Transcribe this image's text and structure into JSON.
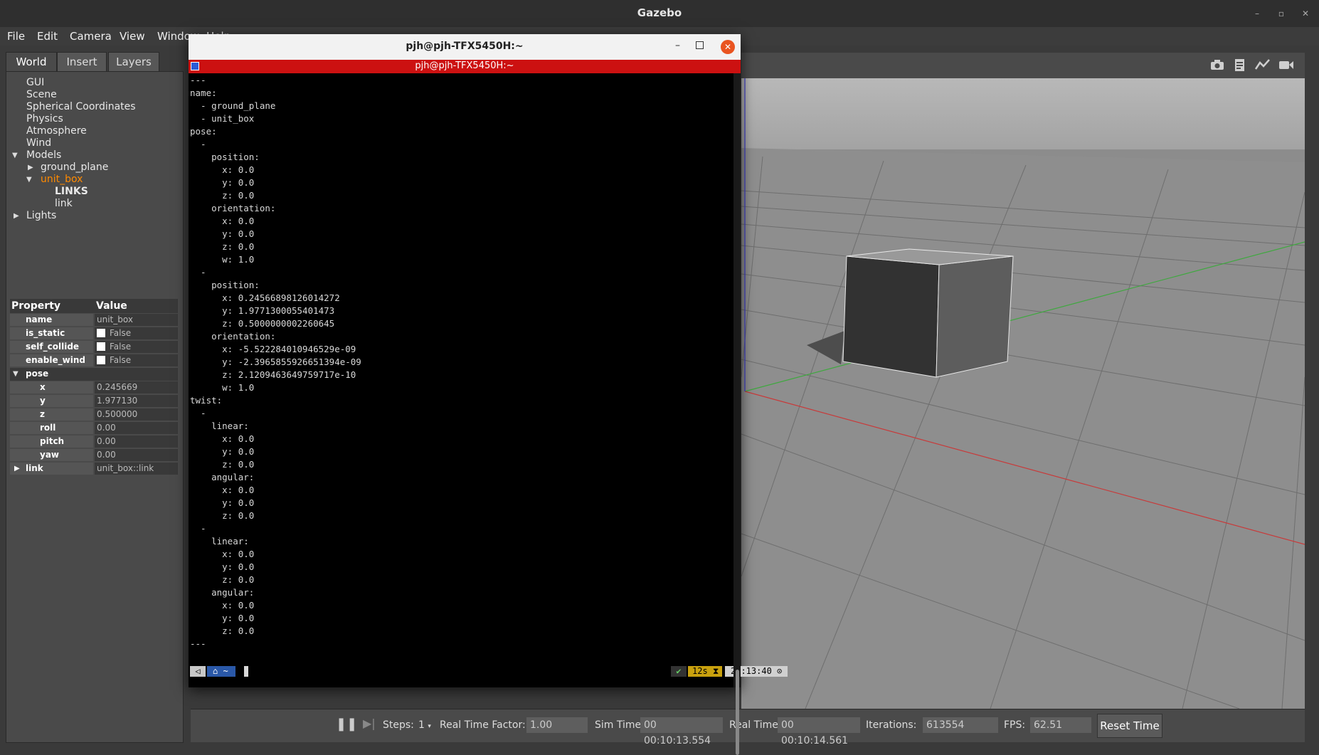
{
  "window": {
    "title": "Gazebo"
  },
  "menu": [
    "File",
    "Edit",
    "Camera",
    "View",
    "Window",
    "Help"
  ],
  "left_panel": {
    "tabs": [
      "World",
      "Insert",
      "Layers"
    ],
    "tree": {
      "gui": "GUI",
      "scene": "Scene",
      "spherical": "Spherical Coordinates",
      "physics": "Physics",
      "atmosphere": "Atmosphere",
      "wind": "Wind",
      "models": "Models",
      "ground_plane": "ground_plane",
      "unit_box": "unit_box",
      "links_header": "LINKS",
      "link": "link",
      "lights": "Lights"
    },
    "properties": {
      "header_property": "Property",
      "header_value": "Value",
      "name_label": "name",
      "name_value": "unit_box",
      "is_static_label": "is_static",
      "is_static_value": "False",
      "self_collide_label": "self_collide",
      "self_collide_value": "False",
      "enable_wind_label": "enable_wind",
      "enable_wind_value": "False",
      "pose_label": "pose",
      "x_label": "x",
      "x_value": "0.245669",
      "y_label": "y",
      "y_value": "1.977130",
      "z_label": "z",
      "z_value": "0.500000",
      "roll_label": "roll",
      "roll_value": "0.00",
      "pitch_label": "pitch",
      "pitch_value": "0.00",
      "yaw_label": "yaw",
      "yaw_value": "0.00",
      "link_label": "link",
      "link_value": "unit_box::link"
    }
  },
  "viewport_toolbar": [
    "camera-icon",
    "log-icon",
    "plot-icon",
    "video-icon"
  ],
  "bottom_bar": {
    "steps_label": "Steps:",
    "steps_value": "1",
    "rtf_label": "Real Time Factor:",
    "rtf_value": "1.00",
    "sim_time_label": "Sim Time:",
    "sim_time_value": "00 00:10:13.554",
    "real_time_label": "Real Time:",
    "real_time_value": "00 00:10:14.561",
    "iterations_label": "Iterations:",
    "iterations_value": "613554",
    "fps_label": "FPS:",
    "fps_value": "62.51",
    "reset_label": "Reset Time"
  },
  "terminal": {
    "title": "pjh@pjh-TFX5450H:~",
    "tab_title": "pjh@pjh-TFX5450H:~",
    "lines": [
      "---",
      "name:",
      "  - ground_plane",
      "  - unit_box",
      "pose:",
      "  -",
      "    position:",
      "      x: 0.0",
      "      y: 0.0",
      "      z: 0.0",
      "    orientation:",
      "      x: 0.0",
      "      y: 0.0",
      "      z: 0.0",
      "      w: 1.0",
      "  -",
      "    position:",
      "      x: 0.24566898126014272",
      "      y: 1.9771300055401473",
      "      z: 0.5000000002260645",
      "    orientation:",
      "      x: -5.522284010946529e-09",
      "      y: -2.3965855926651394e-09",
      "      z: 2.1209463649759717e-10",
      "      w: 1.0",
      "twist:",
      "  -",
      "    linear:",
      "      x: 0.0",
      "      y: 0.0",
      "      z: 0.0",
      "    angular:",
      "      x: 0.0",
      "      y: 0.0",
      "      z: 0.0",
      "  -",
      "    linear:",
      "      x: 0.0",
      "      y: 0.0",
      "      z: 0.0",
      "    angular:",
      "      x: 0.0",
      "      y: 0.0",
      "      z: 0.0",
      "---"
    ],
    "prompt": {
      "home": "~",
      "status": "12s",
      "time": "22:13:40"
    }
  }
}
